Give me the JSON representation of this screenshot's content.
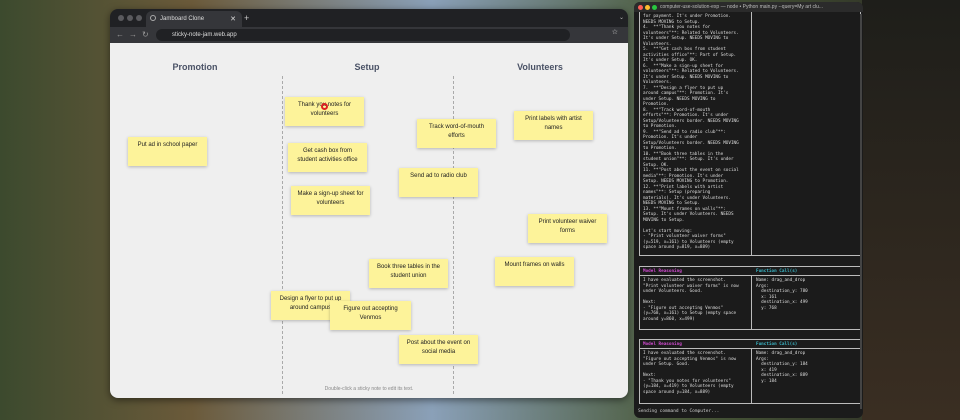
{
  "browser": {
    "tab_title": "Jamboard Clone",
    "url": "sticky-note-jam.web.app"
  },
  "board": {
    "columns": [
      "Promotion",
      "Setup",
      "Volunteers"
    ],
    "notes": [
      "Thank you notes for volunteers",
      "Put ad in school paper",
      "Track word-of-mouth efforts",
      "Print labels with artist names",
      "Get cash box from student activities office",
      "Send ad to radio club",
      "Make a sign-up sheet for volunteers",
      "Print volunteer waiver forms",
      "Book three tables in the student union",
      "Mount frames on walls",
      "Design a flyer to put up around campus",
      "Figure out accepting Venmos",
      "Post about the event on social media"
    ],
    "hint": "Double-click a sticky note to edit its text.",
    "note_color": "#fdf39a"
  },
  "terminal": {
    "title": "computer-use-solution-exp — node • Python main.py --query=My art clu...",
    "log": "for payment. It's under Promotion.\nNEEDS MOVING to Setup.\n4.  **\"Thank you notes for\nvolunteers\"**: Related to Volunteers.\nIt's under Setup. NEEDS MOVING to\nVolunteers.\n5.  **\"Get cash box from student\nactivities office\"**: Part of Setup.\nIt's under Setup. OK.\n6.  **\"Make a sign-up sheet for\nvolunteers\"**: Related to Volunteers.\nIt's under Setup. NEEDS MOVING to\nVolunteers.\n7.  **\"Design a flyer to put up\naround campus\"**: Promotion. It's\nunder Setup. NEEDS MOVING to\nPromotion.\n8.  **\"Track word-of-mouth\nefforts\"**: Promotion. It's under\nSetup/Volunteers border. NEEDS MOVING\nto Promotion.\n9.  **\"Send ad to radio club\"**:\nPromotion. It's under\nSetup/Volunteers border. NEEDS MOVING\nto Promotion.\n10. **\"Book three tables in the\nstudent union\"**: Setup. It's under\nSetup. OK.\n11. **\"Post about the event on social\nmedia\"**: Promotion. It's under\nSetup. NEEDS MOVING to Promotion.\n12. **\"Print labels with artist\nnames\"**: Setup (preparing\nmaterials). It's under Volunteers.\nNEEDS MOVING to Setup.\n13. **\"Mount frames on walls\"**:\nSetup. It's under Volunteers. NEEDS\nMOVING to Setup.\n\nLet's start moving:\n- \"Print volunteer waiver forms\"\n(y=519, x=161) to Volunteers (empty\nspace around y=819, x=889)",
    "panels": [
      {
        "reasoning_label": "Model Reasoning",
        "call_label": "Function Call(s)",
        "reasoning": "I have evaluated the screenshot.\n\"Print volunteer waiver forms\" is now\nunder Volunteers. Good.\n\nNext:\n- \"Figure out accepting Venmos\"\n(y=768, x=161) to Setup (empty space\naround y=860, x=499)",
        "call": "Name: drag_and_drop\nArgs:\n  destination_y: 780\n  x: 161\n  destination_x: 499\n  y: 768"
      },
      {
        "reasoning_label": "Model Reasoning",
        "call_label": "Function Call(s)",
        "reasoning": "I have evaluated the screenshot.\n\"Figure out accepting Venmos\" is now\nunder Setup. Good.\n\nNext:\n- \"Thank you notes for volunteers\"\n(y=184, x=419) to Volunteers (empty\nspace around y=184, x=889)",
        "call": "Name: drag_and_drop\nArgs:\n  destination_y: 184\n  x: 419\n  destination_x: 889\n  y: 184"
      }
    ],
    "status": "Sending command to Computer...",
    "reasoning_color": "#d04ad0",
    "call_color": "#3ab8c8"
  }
}
